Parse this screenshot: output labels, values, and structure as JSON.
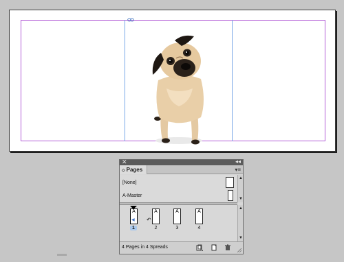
{
  "pages_panel": {
    "tab_label": "Pages",
    "tab_arrows": "◇",
    "close_glyph": "✕",
    "collapse_glyph": "◂◂",
    "menu_glyph": "▾≡",
    "masters": [
      {
        "label": "[None]"
      },
      {
        "label": "A-Master"
      }
    ],
    "pages": [
      {
        "number": "1",
        "prefix": "A",
        "selected": true
      },
      {
        "number": "2",
        "prefix": "A",
        "selected": false
      },
      {
        "number": "3",
        "prefix": "A",
        "selected": false
      },
      {
        "number": "4",
        "prefix": "A",
        "selected": false
      }
    ],
    "status": "4 Pages in 4 Spreads",
    "scroll_up_glyph": "▲",
    "scroll_down_glyph": "▼",
    "rotate_glyph": "↶",
    "handle_glyph": "◀"
  },
  "colors": {
    "margin_guide": "#b25cd6",
    "column_guide": "#78a7e6",
    "selection": "#a9c8ec"
  },
  "icons": [
    "close-icon",
    "collapse-icon",
    "panel-menu-icon",
    "edit-page-size-icon",
    "new-page-icon",
    "trash-icon",
    "resize-grip-icon",
    "link-icon",
    "rotate-spread-icon"
  ]
}
